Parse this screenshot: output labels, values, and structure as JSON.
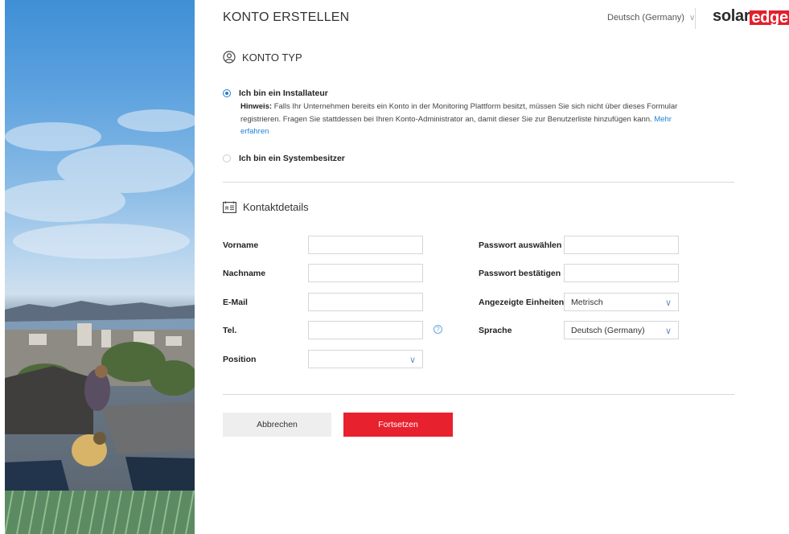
{
  "header": {
    "title": "KONTO ERSTELLEN",
    "language": "Deutsch (Germany)",
    "logo_solar": "solar",
    "logo_edge": "edge",
    "brand_color": "#e8212e"
  },
  "account_type": {
    "heading": "KONTO TYP",
    "icon": "user-circle-icon",
    "options": [
      {
        "label": "Ich bin ein Installateur",
        "selected": true
      },
      {
        "label": "Ich bin ein Systembesitzer",
        "selected": false
      }
    ],
    "hint_label": "Hinweis:",
    "hint_text": " Falls Ihr Unternehmen bereits ein Konto in der Monitoring Plattform besitzt, müssen Sie sich nicht über dieses Formular registrieren. Fragen Sie stattdessen bei Ihren Konto-Administrator an, damit dieser Sie zur Benutzerliste hinzufügen kann. ",
    "hint_link": "Mehr erfahren"
  },
  "contact": {
    "heading": "Kontaktdetails",
    "icon": "contact-card-icon",
    "left_fields": {
      "first_name": "Vorname",
      "last_name": "Nachname",
      "email": "E-Mail",
      "phone": "Tel.",
      "position": "Position"
    },
    "right_fields": {
      "password": "Passwort auswählen",
      "password_confirm": "Passwort bestätigen",
      "units": "Angezeigte Einheiten",
      "units_value": "Metrisch",
      "language": "Sprache",
      "language_value": "Deutsch (Germany)"
    }
  },
  "actions": {
    "cancel": "Abbrechen",
    "continue": "Fortsetzen"
  }
}
